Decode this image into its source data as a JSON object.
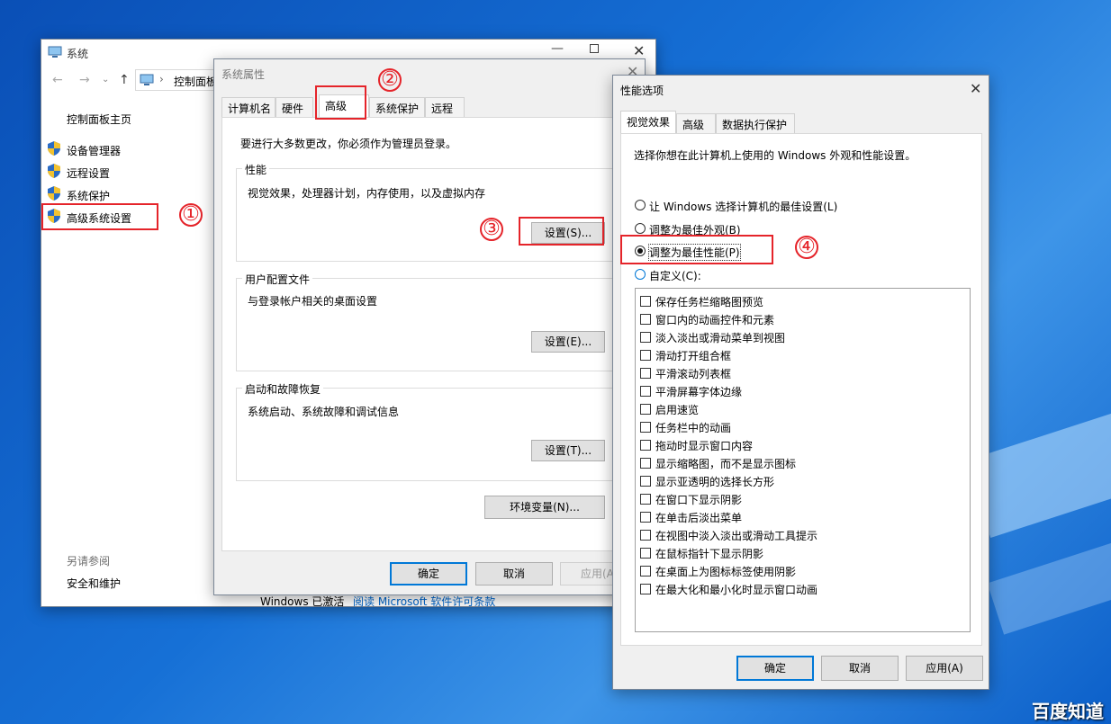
{
  "system_window": {
    "title": "系统",
    "address": "控制面板",
    "home_link": "控制面板主页",
    "nav": [
      "设备管理器",
      "远程设置",
      "系统保护",
      "高级系统设置"
    ],
    "see_also_title": "另请参阅",
    "see_also_link": "安全和维护",
    "activation_text": "Windows 已激活",
    "license_link": "阅读 Microsoft 软件许可条款"
  },
  "sys_props": {
    "title": "系统属性",
    "tabs": [
      "计算机名",
      "硬件",
      "高级",
      "系统保护",
      "远程"
    ],
    "active_tab": "高级",
    "admin_note": "要进行大多数更改，你必须作为管理员登录。",
    "performance": {
      "label": "性能",
      "desc": "视觉效果，处理器计划，内存使用，以及虚拟内存",
      "button": "设置(S)..."
    },
    "profiles": {
      "label": "用户配置文件",
      "desc": "与登录帐户相关的桌面设置",
      "button": "设置(E)..."
    },
    "startup": {
      "label": "启动和故障恢复",
      "desc": "系统启动、系统故障和调试信息",
      "button": "设置(T)..."
    },
    "env_button": "环境变量(N)...",
    "ok": "确定",
    "cancel": "取消",
    "apply": "应用(A"
  },
  "perf_options": {
    "title": "性能选项",
    "tabs": [
      "视觉效果",
      "高级",
      "数据执行保护"
    ],
    "active_tab": "视觉效果",
    "intro": "选择你想在此计算机上使用的 Windows 外观和性能设置。",
    "radios": [
      "让 Windows 选择计算机的最佳设置(L)",
      "调整为最佳外观(B)",
      "调整为最佳性能(P)",
      "自定义(C):"
    ],
    "selected_radio": 2,
    "effects": [
      "保存任务栏缩略图预览",
      "窗口内的动画控件和元素",
      "淡入淡出或滑动菜单到视图",
      "滑动打开组合框",
      "平滑滚动列表框",
      "平滑屏幕字体边缘",
      "启用速览",
      "任务栏中的动画",
      "拖动时显示窗口内容",
      "显示缩略图，而不是显示图标",
      "显示亚透明的选择长方形",
      "在窗口下显示阴影",
      "在单击后淡出菜单",
      "在视图中淡入淡出或滑动工具提示",
      "在鼠标指针下显示阴影",
      "在桌面上为图标标签使用阴影",
      "在最大化和最小化时显示窗口动画"
    ],
    "ok": "确定",
    "cancel": "取消",
    "apply": "应用(A)"
  },
  "annotations": [
    "①",
    "②",
    "③",
    "④"
  ],
  "watermark": "百度知道",
  "colors": {
    "annotation_red": "#e5242a",
    "focus_blue": "#0078d7",
    "link_blue": "#0066cc"
  }
}
